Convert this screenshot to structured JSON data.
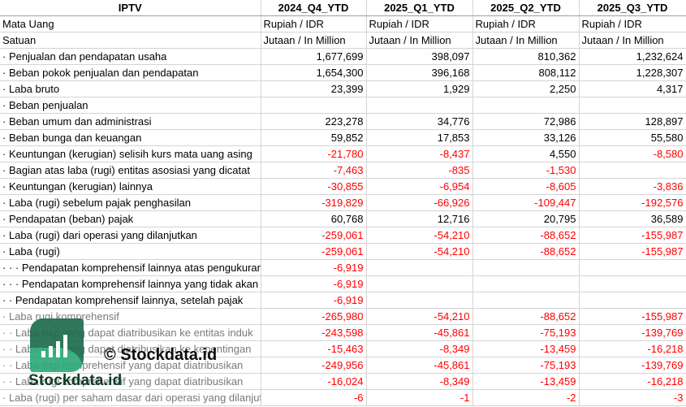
{
  "header": {
    "label": "IPTV",
    "cols": [
      "2024_Q4_YTD",
      "2025_Q1_YTD",
      "2025_Q2_YTD",
      "2025_Q3_YTD"
    ]
  },
  "rows": [
    {
      "label": "Mata Uang",
      "values": [
        "Rupiah / IDR",
        "Rupiah / IDR",
        "Rupiah / IDR",
        "Rupiah / IDR"
      ],
      "kind": "sub"
    },
    {
      "label": "Satuan",
      "values": [
        "Jutaan / In Million",
        "Jutaan / In Million",
        "Jutaan / In Million",
        "Jutaan / In Million"
      ],
      "kind": "sub"
    },
    {
      "label": "· Penjualan dan pendapatan usaha",
      "values": [
        "1,677,699",
        "398,097",
        "810,362",
        "1,232,624"
      ]
    },
    {
      "label": "· Beban pokok penjualan dan pendapatan",
      "values": [
        "1,654,300",
        "396,168",
        "808,112",
        "1,228,307"
      ]
    },
    {
      "label": "· Laba bruto",
      "values": [
        "23,399",
        "1,929",
        "2,250",
        "4,317"
      ]
    },
    {
      "label": "· Beban penjualan",
      "values": [
        "",
        "",
        "",
        ""
      ]
    },
    {
      "label": "· Beban umum dan administrasi",
      "values": [
        "223,278",
        "34,776",
        "72,986",
        "128,897"
      ]
    },
    {
      "label": "· Beban bunga dan keuangan",
      "values": [
        "59,852",
        "17,853",
        "33,126",
        "55,580"
      ]
    },
    {
      "label": "· Keuntungan (kerugian) selisih kurs mata uang asing",
      "values": [
        "-21,780",
        "-8,437",
        "4,550",
        "-8,580"
      ]
    },
    {
      "label": "· Bagian atas laba (rugi) entitas asosiasi yang dicatat",
      "values": [
        "-7,463",
        "-835",
        "-1,530",
        ""
      ]
    },
    {
      "label": "· Keuntungan (kerugian) lainnya",
      "values": [
        "-30,855",
        "-6,954",
        "-8,605",
        "-3,836"
      ]
    },
    {
      "label": "· Laba (rugi) sebelum pajak penghasilan",
      "values": [
        "-319,829",
        "-66,926",
        "-109,447",
        "-192,576"
      ]
    },
    {
      "label": "· Pendapatan (beban) pajak",
      "values": [
        "60,768",
        "12,716",
        "20,795",
        "36,589"
      ]
    },
    {
      "label": "· Laba (rugi) dari operasi yang dilanjutkan",
      "values": [
        "-259,061",
        "-54,210",
        "-88,652",
        "-155,987"
      ]
    },
    {
      "label": "· Laba (rugi)",
      "values": [
        "-259,061",
        "-54,210",
        "-88,652",
        "-155,987"
      ]
    },
    {
      "label": "· · · Pendapatan komprehensif lainnya atas pengukuran",
      "values": [
        "-6,919",
        "",
        "",
        ""
      ]
    },
    {
      "label": "· · · Pendapatan komprehensif lainnya yang tidak akan",
      "values": [
        "-6,919",
        "",
        "",
        ""
      ]
    },
    {
      "label": "· · Pendapatan komprehensif lainnya, setelah pajak",
      "values": [
        "-6,919",
        "",
        "",
        ""
      ]
    },
    {
      "label": "· Laba rugi komprehensif",
      "values": [
        "-265,980",
        "-54,210",
        "-88,652",
        "-155,987"
      ],
      "kind": "grey"
    },
    {
      "label": "· · Laba rugi yang dapat diatribusikan ke entitas induk",
      "values": [
        "-243,598",
        "-45,861",
        "-75,193",
        "-139,769"
      ],
      "kind": "grey"
    },
    {
      "label": "· · Laba rugi yang dapat diatribusikan ke kepentingan",
      "values": [
        "-15,463",
        "-8,349",
        "-13,459",
        "-16,218"
      ],
      "kind": "grey"
    },
    {
      "label": "· · Laba rugi komprehensif yang dapat diatribusikan",
      "values": [
        "-249,956",
        "-45,861",
        "-75,193",
        "-139,769"
      ],
      "kind": "grey"
    },
    {
      "label": "· · Laba rugi komprehensif yang dapat diatribusikan",
      "values": [
        "-16,024",
        "-8,349",
        "-13,459",
        "-16,218"
      ],
      "kind": "grey"
    },
    {
      "label": "· Laba (rugi) per saham dasar dari operasi yang dilanjutkan",
      "values": [
        "-6",
        "-1",
        "-2",
        "-3"
      ],
      "kind": "grey"
    }
  ],
  "watermark": {
    "copyright": "© Stockdata.id",
    "brand": "Stockdata.id",
    "logo_icon": "bar-chart-logo-icon"
  }
}
